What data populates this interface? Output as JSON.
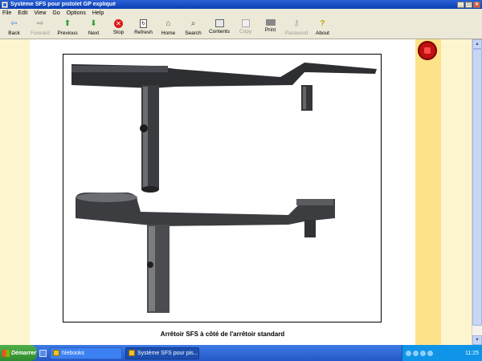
{
  "window": {
    "title": "Système SFS pour pistolet GP expliqué",
    "minimize_glyph": "_",
    "maximize_glyph": "□",
    "close_glyph": "✕"
  },
  "menu": [
    "File",
    "Edit",
    "View",
    "Go",
    "Options",
    "Help"
  ],
  "toolbar": [
    {
      "label": "Back",
      "icon": "arrow-left-icon",
      "glyph": "⇦",
      "enabled": true
    },
    {
      "label": "Forward",
      "icon": "arrow-right-icon",
      "glyph": "⇨",
      "enabled": false
    },
    {
      "label": "Previous",
      "icon": "arrow-up-icon",
      "glyph": "⬆",
      "enabled": true
    },
    {
      "label": "Next",
      "icon": "arrow-down-icon",
      "glyph": "⬇",
      "enabled": true
    },
    {
      "label": "Stop",
      "icon": "stop-icon",
      "glyph": "✕",
      "enabled": true
    },
    {
      "label": "Refresh",
      "icon": "refresh-icon",
      "glyph": "↻",
      "enabled": true
    },
    {
      "label": "Home",
      "icon": "home-icon",
      "glyph": "⌂",
      "enabled": true
    },
    {
      "label": "Search",
      "icon": "search-icon",
      "glyph": "⌕",
      "enabled": true
    },
    {
      "label": "Contents",
      "icon": "contents-icon",
      "glyph": "",
      "enabled": true
    },
    {
      "label": "Copy",
      "icon": "copy-icon",
      "glyph": "",
      "enabled": false
    },
    {
      "label": "Print",
      "icon": "print-icon",
      "glyph": "",
      "enabled": true
    },
    {
      "label": "Password",
      "icon": "key-icon",
      "glyph": "⚷",
      "enabled": false
    },
    {
      "label": "About",
      "icon": "help-icon",
      "glyph": "?",
      "enabled": true
    }
  ],
  "content": {
    "caption": "Arrêtoir SFS à côté de l'arrêtoir standard",
    "photo_subject": "two slide stop parts photographed side by side",
    "colors": {
      "left_band": "#fdf5cf",
      "right_band": "#fde28a",
      "page": "#ffffff"
    }
  },
  "taskbar": {
    "start_label": "Démarrer",
    "tasks": [
      {
        "label": "hlebooks",
        "active": false
      },
      {
        "label": "Système SFS pour pis...",
        "active": true
      }
    ],
    "clock": "11:25"
  }
}
